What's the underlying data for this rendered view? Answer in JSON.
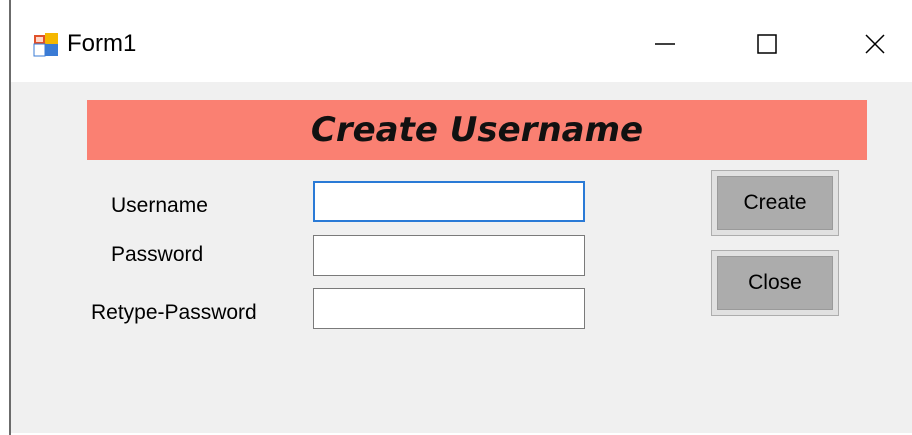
{
  "window": {
    "title": "Form1",
    "icon": "winforms-app-icon",
    "controls": {
      "minimize_icon": "minimize-icon",
      "maximize_icon": "maximize-icon",
      "close_icon": "close-icon"
    }
  },
  "form": {
    "banner": "Create Username",
    "banner_color": "#fa8072",
    "fields": {
      "username_label": "Username",
      "username_value": "",
      "password_label": "Password",
      "password_value": "",
      "retype_label": "Retype-Password",
      "retype_value": ""
    },
    "buttons": {
      "create": "Create",
      "close": "Close"
    }
  }
}
